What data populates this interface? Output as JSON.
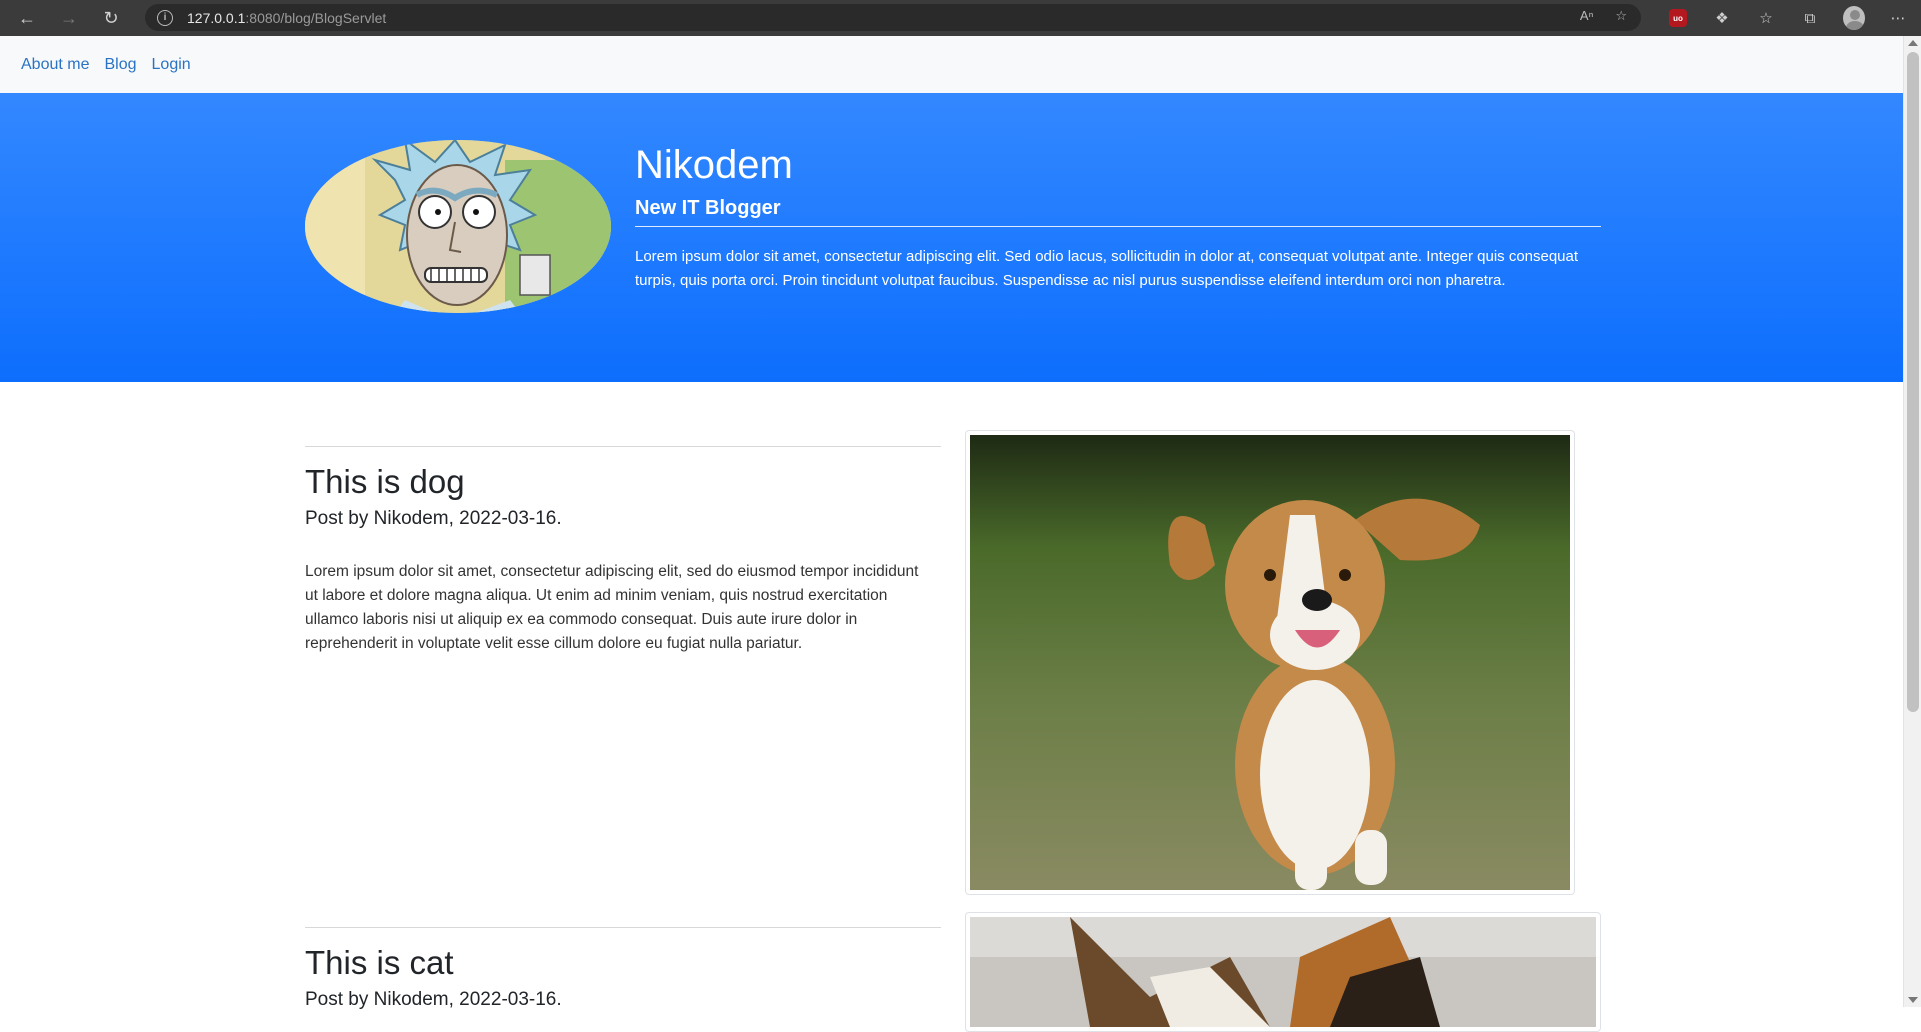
{
  "browser": {
    "url_host": "127.0.0.1",
    "url_path": ":8080/blog/BlogServlet",
    "ublock_label": "uo",
    "icons": [
      "back-icon",
      "forward-icon",
      "reload-icon",
      "info-icon",
      "read-aloud-icon",
      "add-favorite-icon",
      "ublock-icon",
      "extensions-icon",
      "favorites-icon",
      "collections-icon",
      "profile-icon",
      "more-icon"
    ]
  },
  "nav": {
    "items": [
      {
        "label": "About me"
      },
      {
        "label": "Blog"
      },
      {
        "label": "Login"
      }
    ]
  },
  "hero": {
    "name": "Nikodem",
    "subtitle": "New IT Blogger",
    "description": "Lorem ipsum dolor sit amet, consectetur adipiscing elit. Sed odio lacus, sollicitudin in dolor at, consequat volutpat ante. Integer quis consequat turpis, quis porta orci. Proin tincidunt volutpat faucibus. Suspendisse ac nisl purus suspendisse eleifend interdum orci non pharetra."
  },
  "posts": [
    {
      "title": "This is dog",
      "meta": "Post by Nikodem, 2022-03-16.",
      "body": "Lorem ipsum dolor sit amet, consectetur adipiscing elit, sed do eiusmod tempor incididunt ut labore et dolore magna aliqua. Ut enim ad minim veniam, quis nostrud exercitation ullamco laboris nisi ut aliquip ex ea commodo consequat. Duis aute irure dolor in reprehenderit in voluptate velit esse cillum dolore eu fugiat nulla pariatur."
    },
    {
      "title": "This is cat",
      "meta": "Post by Nikodem, 2022-03-16."
    }
  ],
  "colors": {
    "hero_top": "#3388ff",
    "hero_bottom": "#0d6efd",
    "nav_link": "#2a73c4"
  }
}
